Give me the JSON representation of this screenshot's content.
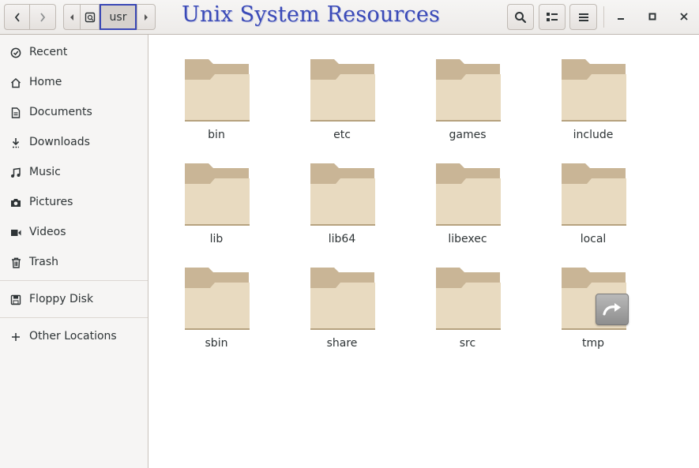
{
  "header": {
    "title": "Unix System Resources",
    "path_current": "usr",
    "icons": {
      "back": "chevron-left-icon",
      "forward": "chevron-right-icon",
      "path_left": "triangle-left-icon",
      "path_home": "drive-icon",
      "path_right": "triangle-right-icon",
      "search": "search-icon",
      "view": "list-view-icon",
      "menu": "hamburger-menu-icon",
      "minimize": "minimize-icon",
      "maximize": "maximize-icon",
      "close": "close-icon"
    }
  },
  "sidebar": {
    "items": [
      {
        "label": "Recent",
        "icon": "clock-icon"
      },
      {
        "label": "Home",
        "icon": "home-icon"
      },
      {
        "label": "Documents",
        "icon": "document-icon"
      },
      {
        "label": "Downloads",
        "icon": "download-icon"
      },
      {
        "label": "Music",
        "icon": "music-icon"
      },
      {
        "label": "Pictures",
        "icon": "camera-icon"
      },
      {
        "label": "Videos",
        "icon": "video-icon"
      },
      {
        "label": "Trash",
        "icon": "trash-icon"
      },
      {
        "label": "Floppy Disk",
        "icon": "floppy-disk-icon"
      },
      {
        "label": "Other Locations",
        "icon": "plus-icon"
      }
    ]
  },
  "folders": [
    {
      "name": "bin"
    },
    {
      "name": "etc"
    },
    {
      "name": "games"
    },
    {
      "name": "include"
    },
    {
      "name": "lib"
    },
    {
      "name": "lib64"
    },
    {
      "name": "libexec"
    },
    {
      "name": "local"
    },
    {
      "name": "sbin"
    },
    {
      "name": "share"
    },
    {
      "name": "src"
    },
    {
      "name": "tmp"
    }
  ],
  "colors": {
    "folder_back": "#c9b596",
    "folder_front": "#e8dac0",
    "accent": "#3a48b5"
  }
}
